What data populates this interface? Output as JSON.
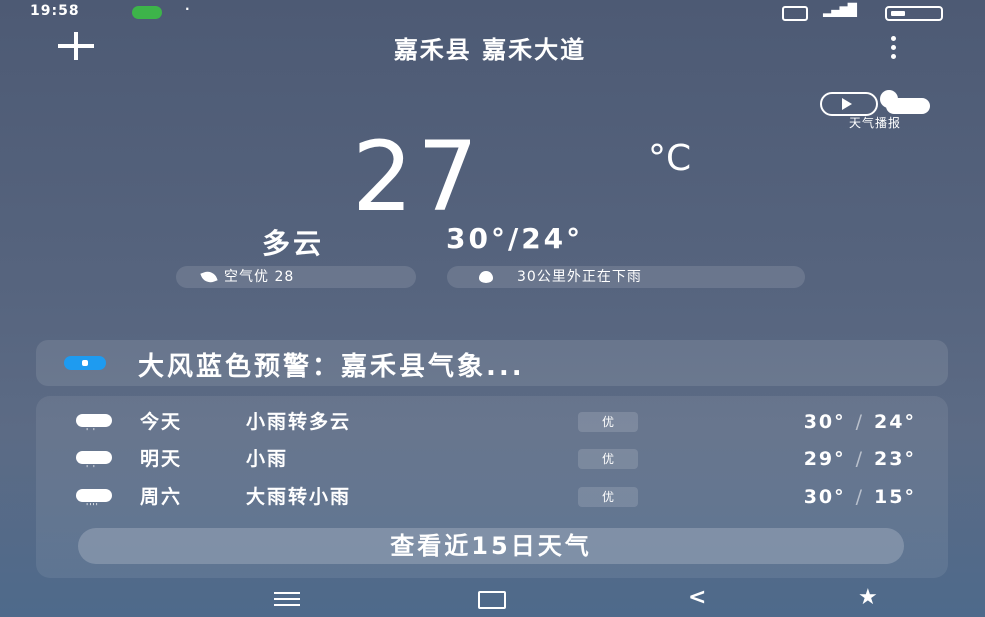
{
  "status_bar": {
    "time": "19:58",
    "icons": [
      "notification-badge-icon",
      "dot-icon",
      "nfc-icon",
      "signal-icon",
      "battery-icon"
    ]
  },
  "header": {
    "location": "嘉禾县 嘉禾大道",
    "add_icon": "plus-icon",
    "more_icon": "more-vertical-icon"
  },
  "broadcast": {
    "label": "天气播报",
    "icon": "play-sun-cloud-icon"
  },
  "current": {
    "temperature": "27",
    "unit": "°C",
    "condition": "多云",
    "high_low": "30°/24°",
    "air_quality": "空气优 28",
    "rain_notice": "30公里外正在下雨"
  },
  "alert": {
    "text": "大风蓝色预警：嘉禾县气象...",
    "badge_color": "#1e9bf0"
  },
  "forecast": [
    {
      "day": "今天",
      "condition": "小雨转多云",
      "aqi": "优",
      "high": "30°",
      "low": "24°",
      "icon": "light-rain-icon"
    },
    {
      "day": "明天",
      "condition": "小雨",
      "aqi": "优",
      "high": "29°",
      "low": "23°",
      "icon": "light-rain-icon"
    },
    {
      "day": "周六",
      "condition": "大雨转小雨",
      "aqi": "优",
      "high": "30°",
      "low": "15°",
      "icon": "heavy-rain-icon"
    }
  ],
  "forecast_sep": "/",
  "view_15_days": "查看近15日天气",
  "nav": {
    "back_glyph": "<",
    "extra_glyph": "★"
  }
}
